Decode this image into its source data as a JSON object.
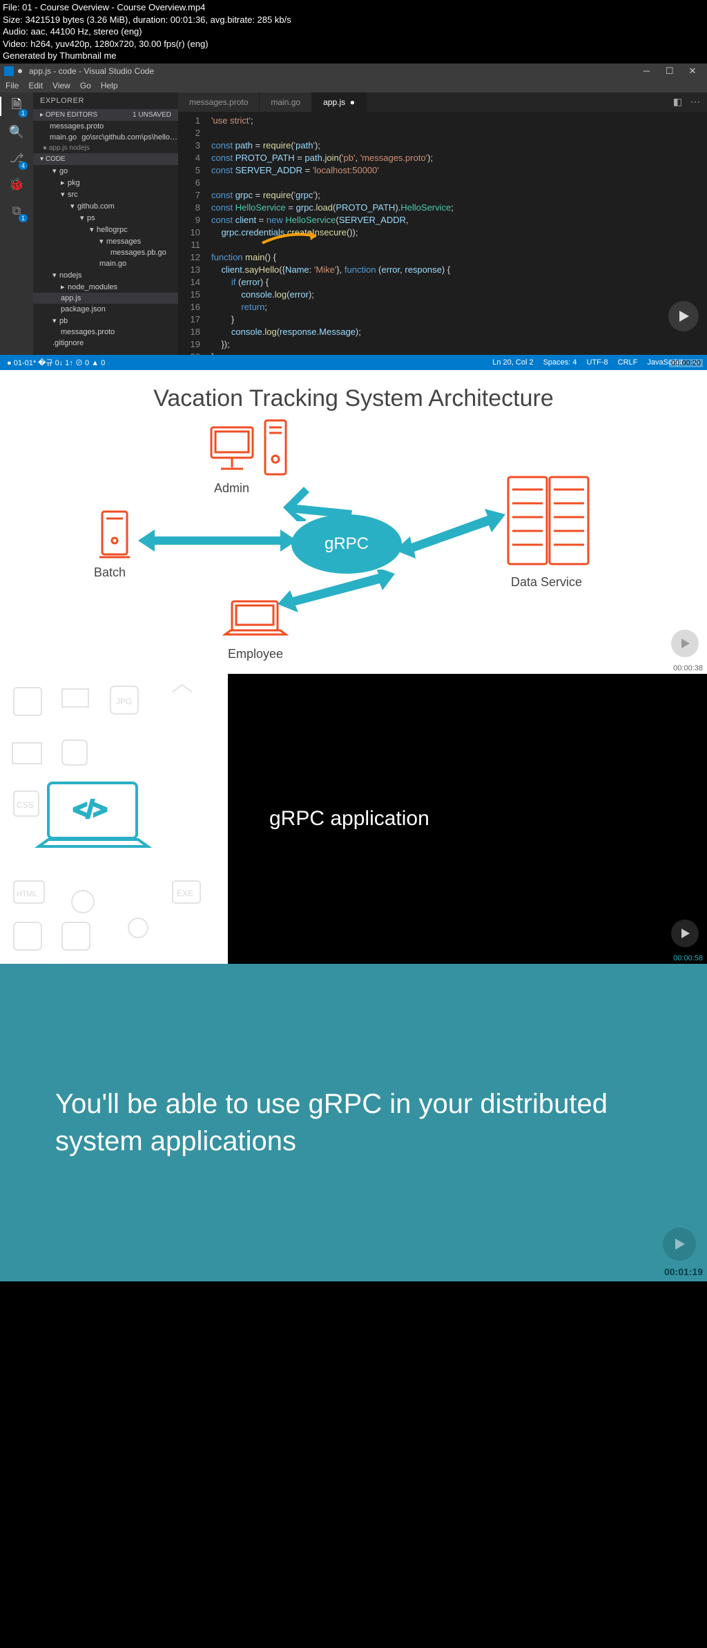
{
  "meta": {
    "file": "File: 01 - Course Overview - Course Overview.mp4",
    "size": "Size: 3421519 bytes (3.26 MiB), duration: 00:01:36, avg.bitrate: 285 kb/s",
    "audio": "Audio: aac, 44100 Hz, stereo (eng)",
    "video": "Video: h264, yuv420p, 1280x720, 30.00 fps(r) (eng)",
    "gen": "Generated by Thumbnail me"
  },
  "vscode": {
    "title": "app.js - code - Visual Studio Code",
    "menu": [
      "File",
      "Edit",
      "View",
      "Go",
      "Help"
    ],
    "explorer": "EXPLORER",
    "openEditors": "OPEN EDITORS",
    "unsaved": "1 UNSAVED",
    "files": {
      "f1": "messages.proto",
      "f2": "main.go",
      "f2path": "go\\src\\github.com\\ps\\hellogrpc",
      "f3": "app.js",
      "f3path": "nodejs"
    },
    "section2": "CODE",
    "tree": {
      "go": "go",
      "pkg": "pkg",
      "src": "src",
      "github": "github.com",
      "ps": "ps",
      "hellogrpc": "hellogrpc",
      "messages": "messages",
      "messagespb": "messages.pb.go",
      "maingo": "main.go",
      "nodejs": "nodejs",
      "node_modules": "node_modules",
      "appjs": "app.js",
      "packagejson": "package.json",
      "pb": "pb",
      "messagesproto": "messages.proto",
      "gitignore": ".gitignore"
    },
    "tabs": [
      "messages.proto",
      "main.go",
      "app.js"
    ],
    "status": {
      "left": "● 01-01* �규 0↓ 1↑  ⊘ 0 ▲ 0",
      "right": [
        "Ln 20, Col 2",
        "Spaces: 4",
        "UTF-8",
        "CRLF",
        "JavaScript",
        "☺"
      ]
    },
    "timestamp": "00:00:20",
    "code": [
      "'use strict';",
      "",
      "const path = require('path');",
      "const PROTO_PATH = path.join('pb', 'messages.proto');",
      "const SERVER_ADDR = 'localhost:50000'",
      "",
      "const grpc = require('grpc');",
      "const HelloService = grpc.load(PROTO_PATH).HelloService;",
      "const client = new HelloService(SERVER_ADDR,",
      "    grpc.credentials.createInsecure());",
      "",
      "function main() {",
      "    client.sayHello({Name: 'Mike'}, function (error, response) {",
      "        if (error) {",
      "            console.log(error);",
      "            return;",
      "        }",
      "        console.log(response.Message);",
      "    });",
      "}"
    ]
  },
  "panel2": {
    "title": "Vacation Tracking System Architecture",
    "center": "gRPC",
    "labels": {
      "admin": "Admin",
      "batch": "Batch",
      "employee": "Employee",
      "data": "Data Service"
    },
    "timestamp": "00:00:38"
  },
  "panel3": {
    "title": "gRPC application",
    "sideLabels": [
      "JPG",
      "CSS",
      "HTML",
      "EXE"
    ],
    "codeGlyph": "</>",
    "timestamp": "00:00:58"
  },
  "panel4": {
    "text": "You'll be able to use gRPC in your distributed system applications",
    "timestamp": "00:01:19"
  }
}
